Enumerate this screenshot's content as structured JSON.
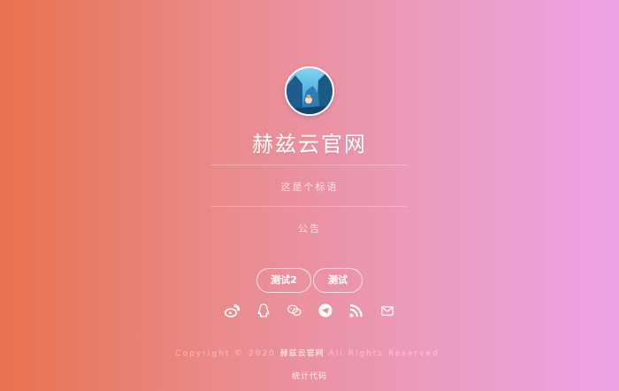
{
  "site": {
    "title": "赫兹云官网",
    "description": "这是个标语",
    "notice": "公告"
  },
  "buttons": [
    {
      "label": "测试2"
    },
    {
      "label": "测试"
    }
  ],
  "social_icons": [
    {
      "name": "weibo-icon"
    },
    {
      "name": "qq-icon"
    },
    {
      "name": "wechat-icon"
    },
    {
      "name": "telegram-icon"
    },
    {
      "name": "rss-icon"
    },
    {
      "name": "mail-icon"
    }
  ],
  "footer": {
    "copyright_prefix": "Copyright © 2020",
    "site_name": "赫兹云官网",
    "copyright_suffix": "All Rights Reserved.",
    "stats_link": "统计代码"
  },
  "colors": {
    "gradient_start": "#e8724e",
    "gradient_mid": "#ec9cc0",
    "gradient_end": "#eda2e6",
    "text": "#ffffff"
  }
}
